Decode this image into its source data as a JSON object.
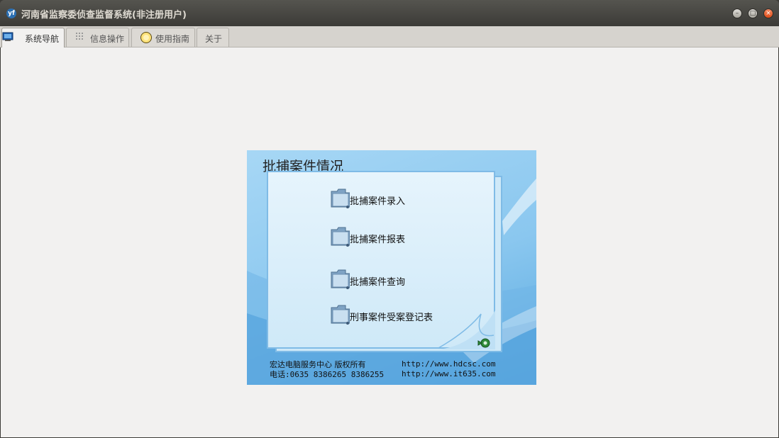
{
  "window": {
    "title": "河南省监察委侦查监督系统(非注册用户)",
    "app_icon_text": "yf",
    "minimize_glyph": "–",
    "maximize_glyph": "□",
    "close_glyph": "×"
  },
  "tabs": [
    {
      "label": "系统导航",
      "icon": "monitor-icon",
      "active": true
    },
    {
      "label": "信息操作",
      "icon": "grid-icon",
      "active": false
    },
    {
      "label": "使用指南",
      "icon": "help-circle-icon",
      "active": false
    },
    {
      "label": "关于",
      "icon": "",
      "active": false
    }
  ],
  "panel": {
    "title": "批捕案件情况",
    "items": [
      {
        "label": "批捕案件录入",
        "icon": "folder-icon"
      },
      {
        "label": "批捕案件报表",
        "icon": "folder-icon"
      },
      {
        "label": "批捕案件查询",
        "icon": "folder-icon"
      },
      {
        "label": "刑事案件受案登记表",
        "icon": "folder-icon"
      }
    ],
    "back_icon": "return-arrow-icon",
    "footer": {
      "company": "宏达电脑服务中心  版权所有",
      "phone_label": "电话",
      "phone": ":0635 8386265 8386255",
      "url1": "http://www.hdcsc.com",
      "url2": "http://www.it635.com"
    }
  },
  "colors": {
    "titlebar": "#3c3b37",
    "panel_blue": "#8ac7ef",
    "paper": "#e6f4fc",
    "close_button": "#df4b16"
  }
}
